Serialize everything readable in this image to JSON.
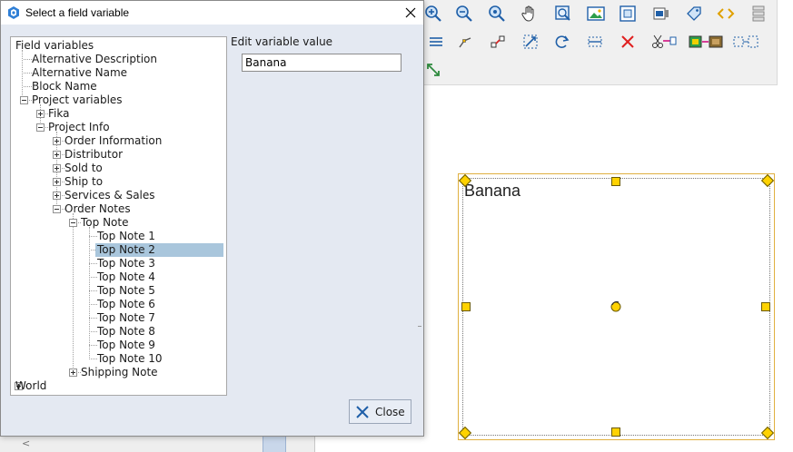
{
  "dialog": {
    "title": "Select a field variable",
    "edit_label": "Edit variable value",
    "edit_value": "Banana",
    "close_label": "Close"
  },
  "tree": {
    "nodes": [
      {
        "label": "Field variables",
        "level": 0,
        "expander": "none"
      },
      {
        "label": "Alternative Description",
        "level": 1,
        "expander": "none"
      },
      {
        "label": "Alternative Name",
        "level": 1,
        "expander": "none"
      },
      {
        "label": "Block Name",
        "level": 1,
        "expander": "none"
      },
      {
        "label": "Project variables",
        "level": 1,
        "expander": "minus"
      },
      {
        "label": "Fika",
        "level": 2,
        "expander": "plus"
      },
      {
        "label": "Project Info",
        "level": 2,
        "expander": "minus"
      },
      {
        "label": "Order Information",
        "level": 3,
        "expander": "plus"
      },
      {
        "label": "Distributor",
        "level": 3,
        "expander": "plus"
      },
      {
        "label": "Sold to",
        "level": 3,
        "expander": "plus"
      },
      {
        "label": "Ship to",
        "level": 3,
        "expander": "plus"
      },
      {
        "label": "Services & Sales",
        "level": 3,
        "expander": "plus"
      },
      {
        "label": "Order Notes",
        "level": 3,
        "expander": "minus"
      },
      {
        "label": "Top Note",
        "level": 4,
        "expander": "minus"
      },
      {
        "label": "Top Note 1",
        "level": 5,
        "expander": "none"
      },
      {
        "label": "Top Note 2",
        "level": 5,
        "expander": "none",
        "selected": true
      },
      {
        "label": "Top Note 3",
        "level": 5,
        "expander": "none"
      },
      {
        "label": "Top Note 4",
        "level": 5,
        "expander": "none"
      },
      {
        "label": "Top Note 5",
        "level": 5,
        "expander": "none"
      },
      {
        "label": "Top Note 6",
        "level": 5,
        "expander": "none"
      },
      {
        "label": "Top Note 7",
        "level": 5,
        "expander": "none"
      },
      {
        "label": "Top Note 8",
        "level": 5,
        "expander": "none"
      },
      {
        "label": "Top Note 9",
        "level": 5,
        "expander": "none"
      },
      {
        "label": "Top Note 10",
        "level": 5,
        "expander": "none"
      },
      {
        "label": "Shipping Note",
        "level": 4,
        "expander": "plus"
      },
      {
        "label": "World",
        "level": 0,
        "expander": "plus"
      }
    ]
  },
  "canvas": {
    "block_text": "Banana"
  },
  "toolbar": {
    "row1": [
      "zoom-in-icon",
      "zoom-out-icon",
      "zoom-extents-icon",
      "pan-hand-icon",
      "zoom-window-icon",
      "image-icon",
      "frame-icon",
      "print-preview-icon",
      "tag-icon",
      "code-icon",
      "stack-icon"
    ],
    "row2": [
      "list-icon",
      "node-edit-icon",
      "connect-icon",
      "scale-icon",
      "rotate-icon",
      "align-icon",
      "delete-icon",
      "cut-icon",
      "group-icon",
      "transform-icon"
    ],
    "row3": [
      "resize-icon"
    ]
  },
  "colors": {
    "selection": "#a9c6dc",
    "handle": "#ffd200",
    "dialog_bg": "#e4e9f2",
    "accent": "#1f6fd1"
  }
}
